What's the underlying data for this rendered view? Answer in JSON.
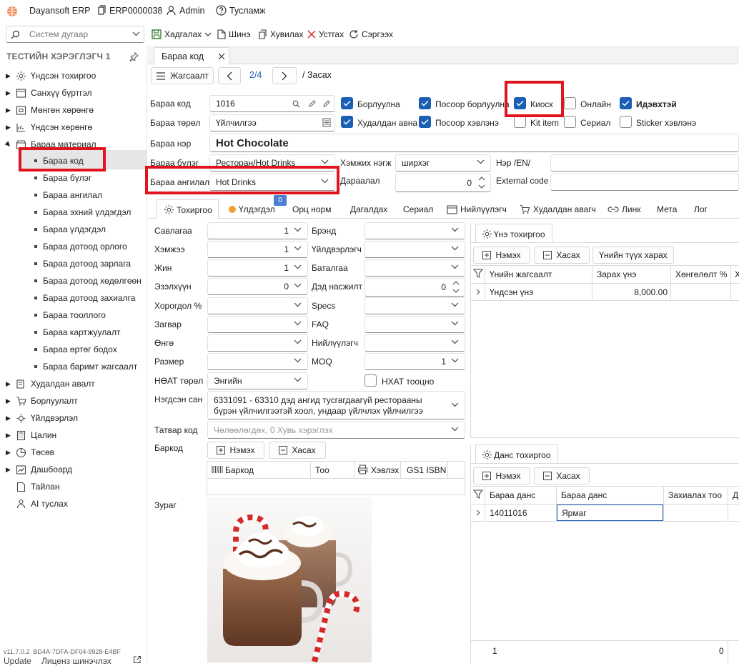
{
  "topbar": {
    "app_name": "Dayansoft ERP",
    "record_code": "ERP0000038",
    "user": "Admin",
    "help": "Тусламж"
  },
  "toolbar": {
    "search_placeholder": "Систем дугаар",
    "save": "Хадгалах",
    "new": "Шинэ",
    "copy": "Хувилах",
    "delete": "Устгах",
    "refresh": "Сэргээх"
  },
  "sidebar": {
    "title": "ТЕСТИЙН ХЭРЭГЛЭГЧ 1",
    "items": [
      {
        "label": "Үндсэн тохиргоо"
      },
      {
        "label": "Санхүү бүртгэл"
      },
      {
        "label": "Мөнгөн хөрөнгө"
      },
      {
        "label": "Үндсэн хөрөнгө"
      },
      {
        "label": "Бараа материал"
      },
      {
        "label": "Худалдан авалт"
      },
      {
        "label": "Борлуулалт"
      },
      {
        "label": "Үйлдвэрлэл"
      },
      {
        "label": "Цалин"
      },
      {
        "label": "Төсөв"
      },
      {
        "label": "Дашбоард"
      },
      {
        "label": "Тайлан"
      },
      {
        "label": "AI туслах"
      }
    ],
    "children": [
      "Бараа код",
      "Бараа бүлэг",
      "Бараа ангилал",
      "Бараа эхний үлдэгдэл",
      "Бараа үлдэгдэл",
      "Бараа дотоод орлого",
      "Бараа дотоод зарлага",
      "Бараа дотоод хөдөлгөөн",
      "Бараа дотоод захиалга",
      "Бараа тооллого",
      "Бараа картжуулалт",
      "Бараа өртөг бодох",
      "Бараа баримт жагсаалт"
    ],
    "version": "v11.7.0.2",
    "license_id": "BD4A-7DFA-DF04-9928-E4BF",
    "update": "Update",
    "license": "Лиценз шинэчлэх"
  },
  "main": {
    "tab": "Бараа код",
    "list_button": "Жагсаалт",
    "pager": "2/4",
    "mode": "/ Засах",
    "fields": {
      "code_label": "Бараа код",
      "code_value": "1016",
      "type_label": "Бараа төрөл",
      "type_value": "Үйлчилгээ",
      "name_label": "Бараа нэр",
      "name_value": "Hot Chocolate",
      "group_label": "Бараа бүлэг",
      "group_value": "Ресторан/Hot Drinks",
      "category_label": "Бараа ангилал",
      "category_value": "Hot Drinks",
      "unit_label": "Хэмжих нэгж",
      "unit_value": "ширхэг",
      "order_label": "Дараалал",
      "order_value": "0",
      "name_en_label": "Нэр /EN/",
      "external_label": "External code"
    },
    "checks": [
      {
        "label": "Борлуулна",
        "checked": true
      },
      {
        "label": "Посоор борлуулна",
        "checked": true
      },
      {
        "label": "Киоск",
        "checked": true
      },
      {
        "label": "Онлайн",
        "checked": false
      },
      {
        "label": "Идэвхтэй",
        "checked": true
      },
      {
        "label": "Худалдан авна",
        "checked": true
      },
      {
        "label": "Посоор хэвлэнэ",
        "checked": true
      },
      {
        "label": "Kit item",
        "checked": false
      },
      {
        "label": "Сериал",
        "checked": false
      },
      {
        "label": "Sticker хэвлэнэ",
        "checked": false
      }
    ],
    "subtabs": [
      "Тохиргоо",
      "Үлдэгдэл",
      "Орц норм",
      "Дагалдах",
      "Сериал",
      "Нийлүүлэгч",
      "Худалдан авагч",
      "Линк",
      "Мета",
      "Лог"
    ],
    "subtab_badge": "0",
    "settings": {
      "left": [
        {
          "label": "Савлагаа",
          "value": "1"
        },
        {
          "label": "Хэмжээ",
          "value": "1"
        },
        {
          "label": "Жин",
          "value": "1"
        },
        {
          "label": "Эзэлхүүн",
          "value": "0"
        },
        {
          "label": "Хорогдол %",
          "value": ""
        },
        {
          "label": "Загвар",
          "value": ""
        },
        {
          "label": "Өнгө",
          "value": ""
        },
        {
          "label": "Размер",
          "value": ""
        },
        {
          "label": "НӨАТ төрөл",
          "value": "Энгийн"
        }
      ],
      "right": [
        {
          "label": "Брэнд",
          "value": ""
        },
        {
          "label": "Үйлдвэрлэгч",
          "value": ""
        },
        {
          "label": "Баталгаа",
          "value": ""
        },
        {
          "label": "Дэд насжилт",
          "value": "0"
        },
        {
          "label": "Specs",
          "value": ""
        },
        {
          "label": "FAQ",
          "value": ""
        },
        {
          "label": "Нийлүүлэгч",
          "value": ""
        },
        {
          "label": "MOQ",
          "value": "1"
        }
      ],
      "nhat_label": "НХАТ тооцно",
      "consolidated_label": "Нэгдсэн сан",
      "consolidated_value": "6331091 - 63310 дэд ангид тусгагдаагүй ресторааны бүрэн үйлчилгээтэй хоол, ундаар үйлчлэх үйлчилгээ",
      "tax_code_label": "Татвар код",
      "tax_code_value": "Чөлөөлөгдөх, 0 Хувь хэрэглэх",
      "barcode_label": "Баркод",
      "add_button": "Нэмэх",
      "remove_button": "Хасах",
      "barcode_cols": [
        "Баркод",
        "Тоо",
        "Хэвлэх",
        "GS1 ISBN"
      ],
      "image_label": "Зураг"
    },
    "price_panel": {
      "title": "Үнэ тохиргоо",
      "add": "Нэмэх",
      "remove": "Хасах",
      "history": "Үнийн түүх харах",
      "cols": [
        "Үнийн жагсаалт",
        "Зарах үнэ",
        "Хөнгөлөлт %",
        "Х"
      ],
      "rows": [
        {
          "list": "Үндсэн үнэ",
          "price": "8,000.00",
          "discount": ""
        }
      ]
    },
    "account_panel": {
      "title": "Данс тохиргоо",
      "add": "Нэмэх",
      "remove": "Хасах",
      "cols": [
        "Бараа данс",
        "Бараа данс",
        "Захиалах тоо",
        "Д"
      ],
      "rows": [
        {
          "account": "14011016",
          "name": "Ярмаг",
          "qty": ""
        }
      ],
      "footer_count": "1",
      "footer_total": "0"
    }
  },
  "colors": {
    "accent": "#1a5fb4",
    "highlight": "#e0141e",
    "selected": "#e6e6e6",
    "badge": "#4a7fd4",
    "orange_dot": "#f0a030"
  }
}
